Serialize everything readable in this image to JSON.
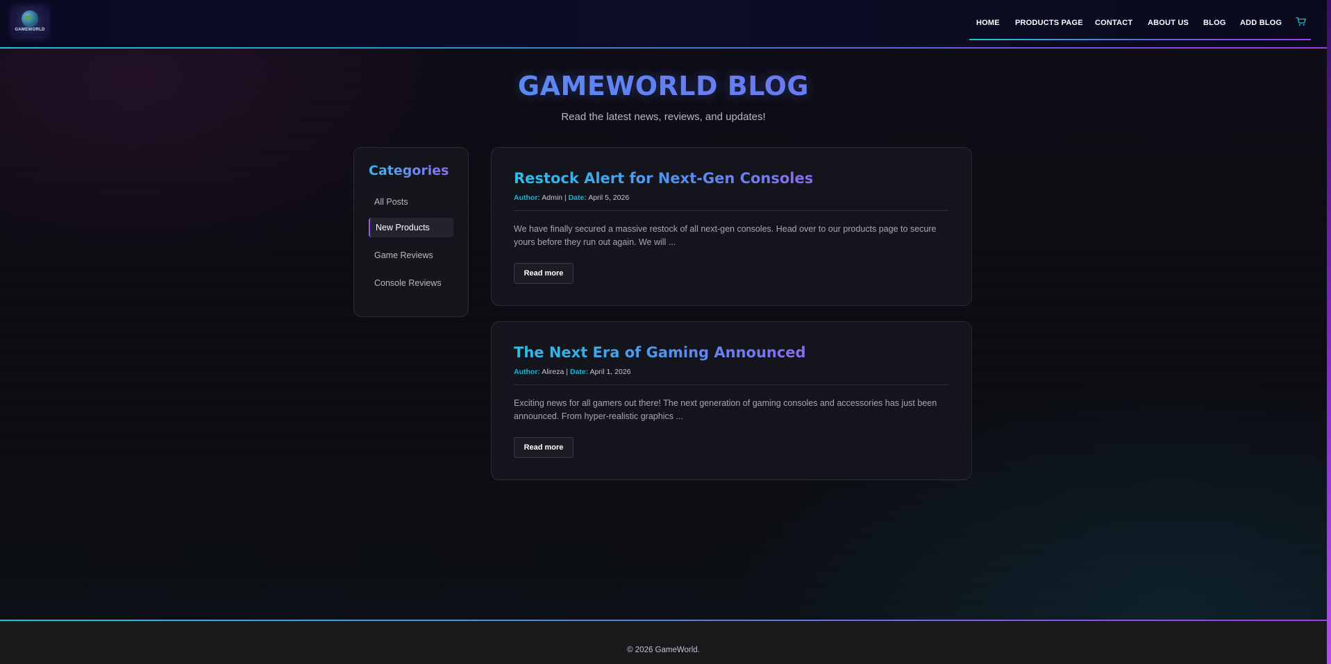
{
  "header": {
    "logo_text": "GAMEWORLD",
    "nav": {
      "home": "HOME",
      "products": "PRODUCTS PAGE",
      "contact": "CONTACT",
      "about": "ABOUT US",
      "blog": "BLOG",
      "add_blog": "ADD BLOG",
      "cart_icon": "cart-icon"
    }
  },
  "hero": {
    "title": "GAMEWORLD BLOG",
    "subtitle": "Read the latest news, reviews, and updates!"
  },
  "sidebar": {
    "title": "Categories",
    "items": [
      {
        "label": "All Posts",
        "active": false
      },
      {
        "label": "New Products",
        "active": true
      },
      {
        "label": "Game Reviews",
        "active": false
      },
      {
        "label": "Console Reviews",
        "active": false
      }
    ]
  },
  "posts": [
    {
      "title": "Restock Alert for Next-Gen Consoles",
      "author_label": "Author:",
      "author": "Admin",
      "date_label": "Date:",
      "date": "April 5, 2026",
      "excerpt": "We have finally secured a massive restock of all next-gen consoles. Head over to our products page to secure yours before they run out again. We will ...",
      "read_more": "Read more"
    },
    {
      "title": "The Next Era of Gaming Announced",
      "author_label": "Author:",
      "author": "Alireza",
      "date_label": "Date:",
      "date": "April 1, 2026",
      "excerpt": "Exciting news for all gamers out there! The next generation of gaming consoles and accessories has just been announced. From hyper-realistic graphics ...",
      "read_more": "Read more"
    }
  ],
  "footer": {
    "text": "© 2026 GameWorld."
  },
  "colors": {
    "accent_cyan": "#19c6d8",
    "accent_purple": "#a33ce8",
    "background": "#0c0c12"
  }
}
